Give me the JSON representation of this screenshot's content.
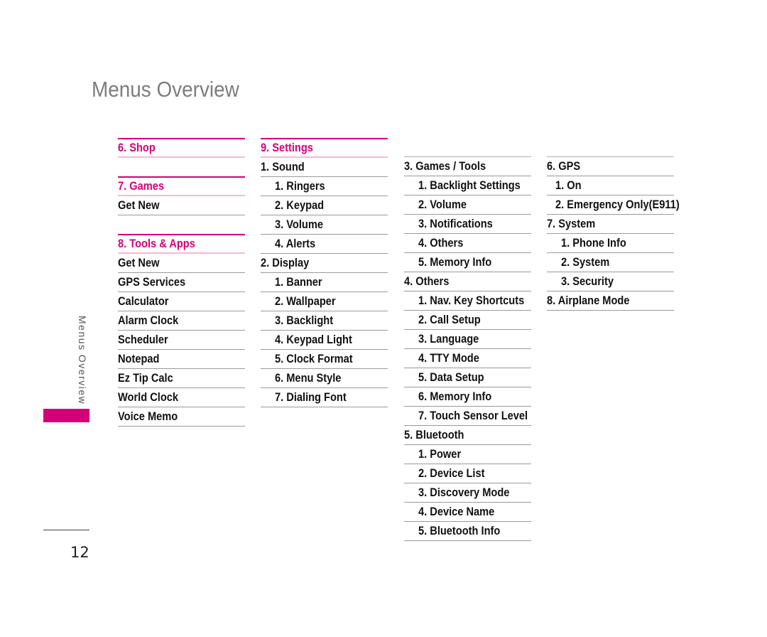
{
  "page": {
    "title": "Menus Overview",
    "side_label": "Menus Overview",
    "page_number": "12",
    "accent_color": "#d4007a"
  },
  "columns": [
    {
      "sections": [
        {
          "heading": "6. Shop",
          "items": []
        },
        {
          "heading": "7. Games",
          "items": [
            "Get New"
          ]
        },
        {
          "heading": "8. Tools & Apps",
          "items": [
            "Get New",
            "GPS Services",
            "Calculator",
            "Alarm Clock",
            "Scheduler",
            "Notepad",
            "Ez Tip Calc",
            "World Clock",
            "Voice Memo"
          ]
        }
      ]
    },
    {
      "heading": "9. Settings",
      "rows": [
        {
          "label": "1. Sound",
          "level": 0
        },
        {
          "label": "1. Ringers",
          "level": 1
        },
        {
          "label": "2. Keypad",
          "level": 1
        },
        {
          "label": "3. Volume",
          "level": 1
        },
        {
          "label": "4. Alerts",
          "level": 1
        },
        {
          "label": "2. Display",
          "level": 0
        },
        {
          "label": "1. Banner",
          "level": 1
        },
        {
          "label": "2. Wallpaper",
          "level": 1
        },
        {
          "label": "3. Backlight",
          "level": 1
        },
        {
          "label": "4. Keypad Light",
          "level": 1
        },
        {
          "label": "5. Clock Format",
          "level": 1
        },
        {
          "label": "6. Menu Style",
          "level": 1
        },
        {
          "label": "7. Dialing Font",
          "level": 1
        }
      ]
    },
    {
      "rows": [
        {
          "label": "3. Games / Tools",
          "level": 0
        },
        {
          "label": "1. Backlight Settings",
          "level": 1
        },
        {
          "label": "2. Volume",
          "level": 1
        },
        {
          "label": "3. Notifications",
          "level": 1
        },
        {
          "label": "4. Others",
          "level": 1
        },
        {
          "label": "5. Memory Info",
          "level": 1
        },
        {
          "label": "4. Others",
          "level": 0
        },
        {
          "label": "1. Nav. Key Shortcuts",
          "level": 1
        },
        {
          "label": "2. Call Setup",
          "level": 1
        },
        {
          "label": "3. Language",
          "level": 1
        },
        {
          "label": "4. TTY Mode",
          "level": 1
        },
        {
          "label": "5. Data Setup",
          "level": 1
        },
        {
          "label": "6. Memory Info",
          "level": 1
        },
        {
          "label": "7. Touch Sensor Level",
          "level": 1
        },
        {
          "label": "5. Bluetooth",
          "level": 0
        },
        {
          "label": "1. Power",
          "level": 1
        },
        {
          "label": "2. Device List",
          "level": 1
        },
        {
          "label": "3. Discovery Mode",
          "level": 1
        },
        {
          "label": "4. Device Name",
          "level": 1
        },
        {
          "label": "5. Bluetooth Info",
          "level": 1
        }
      ]
    },
    {
      "rows": [
        {
          "label": "6. GPS",
          "level": 0
        },
        {
          "label": "1. On",
          "level": 2
        },
        {
          "label": "2. Emergency Only(E911)",
          "level": 2
        },
        {
          "label": "7. System",
          "level": 0
        },
        {
          "label": "1. Phone Info",
          "level": 1
        },
        {
          "label": "2. System",
          "level": 1
        },
        {
          "label": "3. Security",
          "level": 1
        },
        {
          "label": "8. Airplane Mode",
          "level": 0
        }
      ]
    }
  ]
}
